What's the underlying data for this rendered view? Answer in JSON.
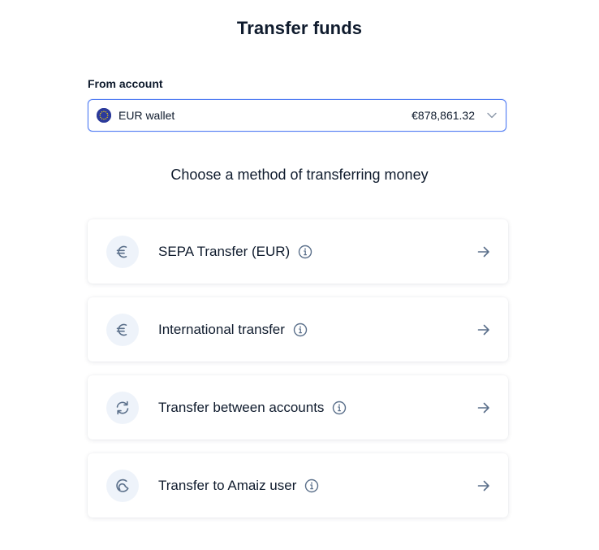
{
  "header": {
    "title": "Transfer funds"
  },
  "from_account": {
    "label": "From account",
    "selected": {
      "name": "EUR wallet",
      "balance": "€878,861.32",
      "flag_icon": "eu-flag-icon"
    }
  },
  "methods_heading": "Choose a method of transferring money",
  "methods": [
    {
      "label": "SEPA Transfer (EUR)",
      "icon": "euro-icon"
    },
    {
      "label": "International transfer",
      "icon": "euro-icon"
    },
    {
      "label": "Transfer between accounts",
      "icon": "refresh-icon"
    },
    {
      "label": "Transfer to Amaiz user",
      "icon": "amaiz-user-icon"
    }
  ],
  "colors": {
    "accent": "#4f7bf3",
    "text": "#0f1b2d",
    "icon_bg": "#eef3fa",
    "icon_fg": "#5a6f8a"
  }
}
